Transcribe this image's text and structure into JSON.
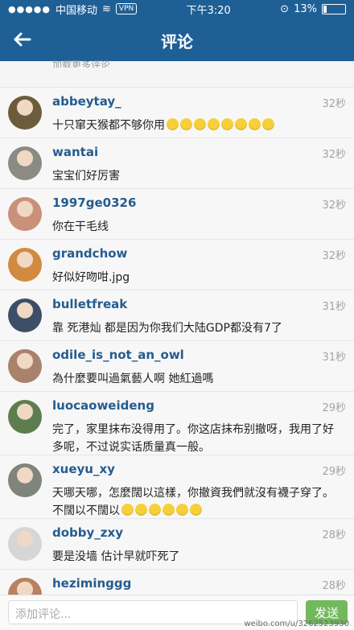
{
  "status_bar": {
    "carrier": "中国移动",
    "vpn": "VPN",
    "time": "下午3:20",
    "battery": "13%"
  },
  "header": {
    "title": "评论"
  },
  "load_more": "加载更多评论",
  "comments": [
    {
      "user": "abbeytay_",
      "time": "32秒",
      "text": "十只窜天猴都不够你用",
      "emoji_count": 8
    },
    {
      "user": "wantai",
      "time": "32秒",
      "text": "宝宝们好厉害"
    },
    {
      "user": "1997ge0326",
      "time": "32秒",
      "text": "你在干毛线"
    },
    {
      "user": "grandchow",
      "time": "32秒",
      "text": "好似好吻咁.jpg"
    },
    {
      "user": "bulletfreak",
      "time": "31秒",
      "text": "靠 死港灿 都是因为你我们大陆GDP都没有7了"
    },
    {
      "user": "odile_is_not_an_owl",
      "time": "31秒",
      "text": "為什麼要叫過氣藝人啊 她紅過嗎"
    },
    {
      "user": "luocaoweideng",
      "time": "29秒",
      "text": "完了，家里抹布没得用了。你这店抹布别撤呀，我用了好多呢，不过说实话质量真一般。"
    },
    {
      "user": "xueyu_xy",
      "time": "29秒",
      "text": "天哪天哪，怎麼闊以這樣，你撤資我們就沒有襪子穿了。不闊以不闊以",
      "emoji_count": 6
    },
    {
      "user": "dobby_zxy",
      "time": "28秒",
      "text": "要是没墙 估计早就吓死了"
    },
    {
      "user": "heziminggg",
      "time": "28秒",
      "text": ""
    }
  ],
  "input": {
    "placeholder": "添加评论..."
  },
  "send_label": "发送",
  "watermark": "weibo.com/u/3262523930"
}
